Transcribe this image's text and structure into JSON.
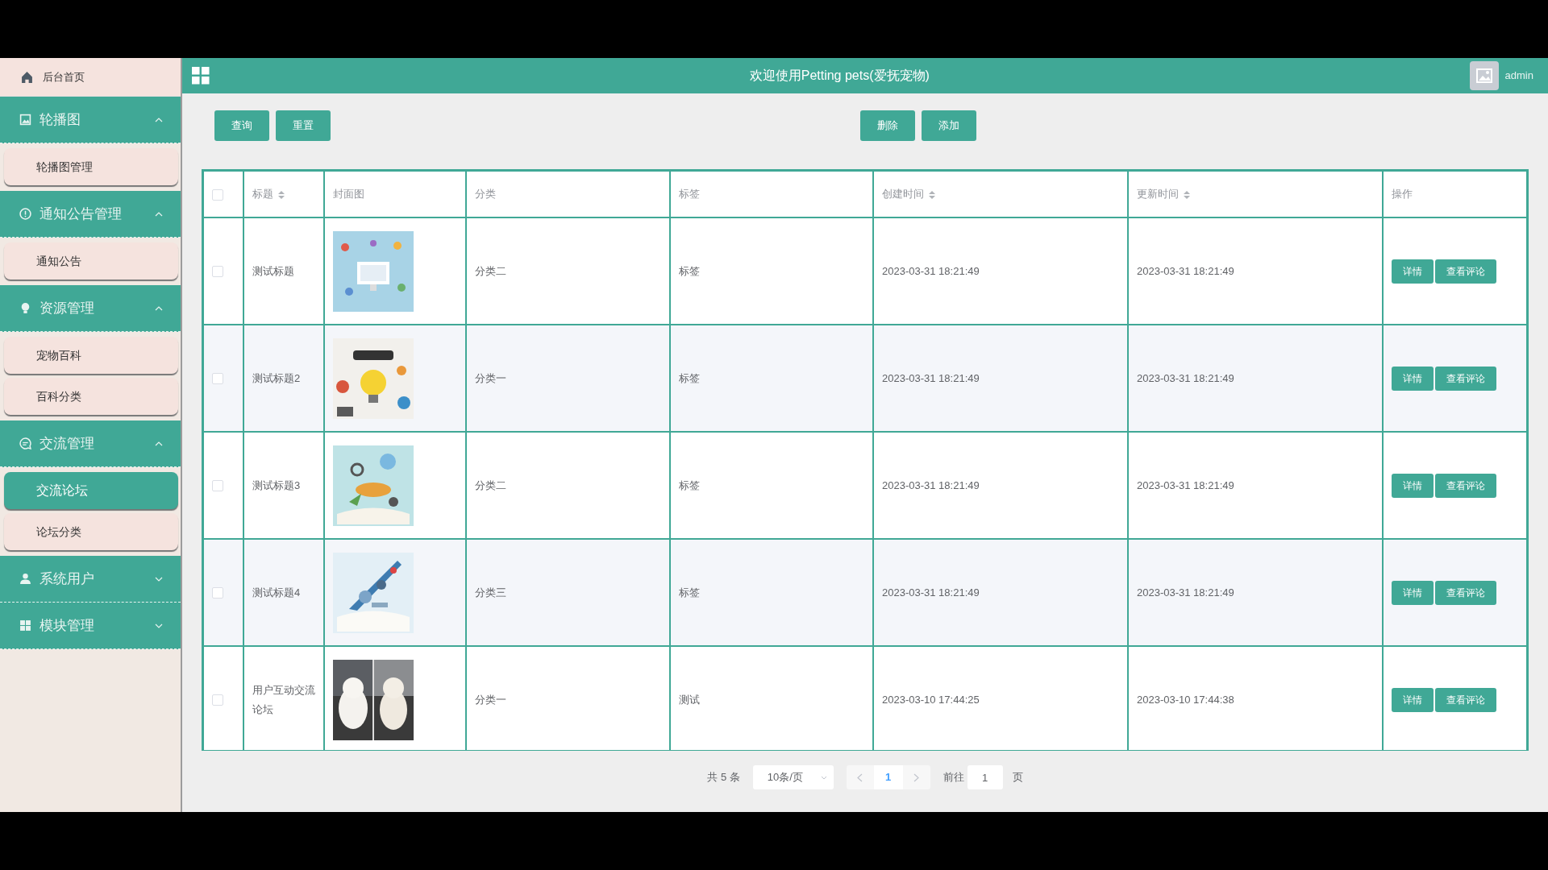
{
  "sidebar": {
    "items": [
      {
        "kind": "link",
        "label": "后台首页"
      },
      {
        "kind": "group",
        "label": "轮播图",
        "expanded": true,
        "children": [
          {
            "label": "轮播图管理",
            "selected": false
          }
        ]
      },
      {
        "kind": "group",
        "label": "通知公告管理",
        "expanded": true,
        "children": [
          {
            "label": "通知公告",
            "selected": false
          }
        ]
      },
      {
        "kind": "group",
        "label": "资源管理",
        "expanded": true,
        "children": [
          {
            "label": "宠物百科",
            "selected": false
          },
          {
            "label": "百科分类",
            "selected": false
          }
        ]
      },
      {
        "kind": "group",
        "label": "交流管理",
        "expanded": true,
        "children": [
          {
            "label": "交流论坛",
            "selected": true
          },
          {
            "label": "论坛分类",
            "selected": false
          }
        ]
      },
      {
        "kind": "group",
        "label": "系统用户",
        "expanded": false
      },
      {
        "kind": "group",
        "label": "模块管理",
        "expanded": false
      }
    ]
  },
  "header": {
    "title": "欢迎使用Petting pets(爱抚宠物)",
    "user": "admin"
  },
  "toolbar": {
    "left": [
      "查询",
      "重置"
    ],
    "right": [
      "删除",
      "添加"
    ]
  },
  "table": {
    "select_all_checked": false,
    "columns": [
      {
        "label": "标题",
        "sortable": true
      },
      {
        "label": "封面图",
        "sortable": false
      },
      {
        "label": "分类",
        "sortable": false
      },
      {
        "label": "标签",
        "sortable": false
      },
      {
        "label": "创建时间",
        "sortable": true
      },
      {
        "label": "更新时间",
        "sortable": true
      },
      {
        "label": "操作",
        "sortable": false
      }
    ],
    "rows": [
      {
        "checked": false,
        "title": "测试标题",
        "category": "分类二",
        "tag": "标签",
        "created": "2023-03-31 18:21:49",
        "updated": "2023-03-31 18:21:49",
        "actions": [
          "详情",
          "查看评论"
        ]
      },
      {
        "checked": false,
        "title": "测试标题2",
        "category": "分类一",
        "tag": "标签",
        "created": "2023-03-31 18:21:49",
        "updated": "2023-03-31 18:21:49",
        "actions": [
          "详情",
          "查看评论"
        ]
      },
      {
        "checked": false,
        "title": "测试标题3",
        "category": "分类二",
        "tag": "标签",
        "created": "2023-03-31 18:21:49",
        "updated": "2023-03-31 18:21:49",
        "actions": [
          "详情",
          "查看评论"
        ]
      },
      {
        "checked": false,
        "title": "测试标题4",
        "category": "分类三",
        "tag": "标签",
        "created": "2023-03-31 18:21:49",
        "updated": "2023-03-31 18:21:49",
        "actions": [
          "详情",
          "查看评论"
        ]
      },
      {
        "checked": false,
        "title": "用户互动交流论坛",
        "category": "分类一",
        "tag": "测试",
        "created": "2023-03-10 17:44:25",
        "updated": "2023-03-10 17:44:38",
        "actions": [
          "详情",
          "查看评论"
        ]
      }
    ]
  },
  "pagination": {
    "total": "共 5 条",
    "page_size": "10条/页",
    "pages": [
      {
        "label": "1",
        "selected": true
      }
    ],
    "goto_label": "前往",
    "goto_value": "1",
    "goto_suffix": "页"
  }
}
